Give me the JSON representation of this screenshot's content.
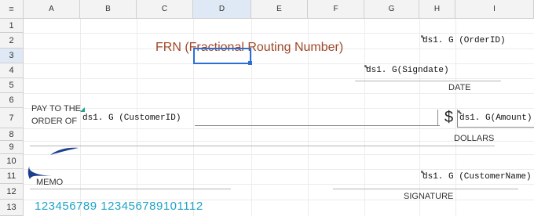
{
  "spreadsheet": {
    "corner_label": "≡",
    "columns": [
      "A",
      "B",
      "C",
      "D",
      "E",
      "F",
      "G",
      "H",
      "I"
    ],
    "rows": [
      "1",
      "2",
      "3",
      "4",
      "5",
      "6",
      "7",
      "8",
      "9",
      "10",
      "11",
      "12",
      "13"
    ],
    "selected_column": "D",
    "selected_row": "3"
  },
  "check": {
    "frn_title": "FRN (Fractional Routing Number)",
    "order_id_field": "ds1. G (OrderID)",
    "signdate_field": "ds1. G(Signdate)",
    "date_label": "DATE",
    "pay_to_line1": "PAY TO THE",
    "pay_to_line2": "ORDER OF",
    "customer_id_field": "ds1. G (CustomerID)",
    "dollar_sign": "$",
    "amount_field": "ds1. G(Amount)",
    "dollars_label": "DOLLARS",
    "memo_label": "MEMO",
    "customer_name_field": "ds1. G (CustomerName)",
    "signature_label": "SIGNATURE",
    "micr_line": "123456789  123456789101112"
  },
  "colors": {
    "frn_text": "#a04a2a",
    "selection": "#2b6fd6",
    "micr_text": "#1fa3c6",
    "logo_blue": "#1b3f8f"
  }
}
